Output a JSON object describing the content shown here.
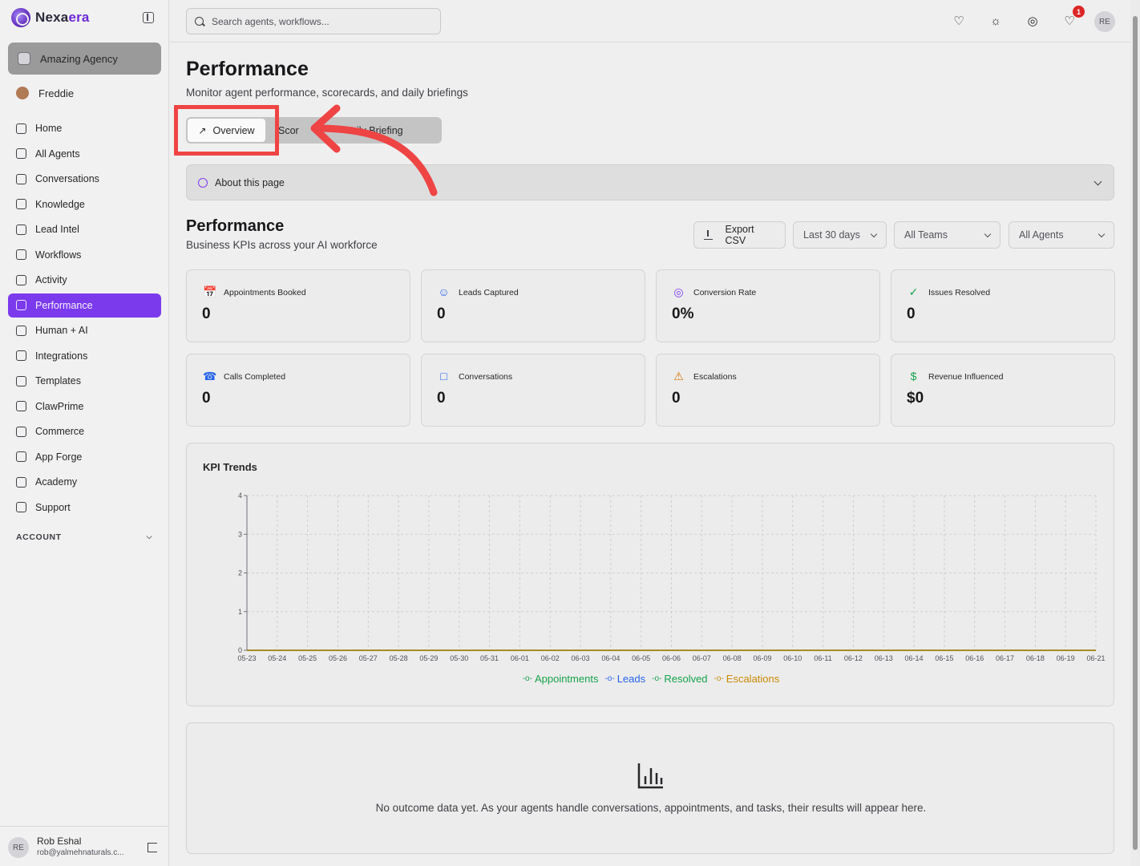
{
  "brand": {
    "name_part1": "Nexa",
    "name_part2": "era"
  },
  "workspace": {
    "name": "Amazing Agency"
  },
  "current_user": {
    "name": "Freddie"
  },
  "sidebar": {
    "items": [
      {
        "label": "Home",
        "icon": "home-icon"
      },
      {
        "label": "All Agents",
        "icon": "bot-icon"
      },
      {
        "label": "Conversations",
        "icon": "message-icon"
      },
      {
        "label": "Knowledge",
        "icon": "brain-icon"
      },
      {
        "label": "Lead Intel",
        "icon": "contact-icon"
      },
      {
        "label": "Workflows",
        "icon": "workflow-icon"
      },
      {
        "label": "Activity",
        "icon": "activity-icon"
      },
      {
        "label": "Performance",
        "icon": "trending-up-icon",
        "active": true
      },
      {
        "label": "Human + AI",
        "icon": "people-icon"
      },
      {
        "label": "Integrations",
        "icon": "plug-icon"
      },
      {
        "label": "Templates",
        "icon": "share-icon"
      },
      {
        "label": "ClawPrime",
        "icon": "claw-icon"
      },
      {
        "label": "Commerce",
        "icon": "cart-icon"
      },
      {
        "label": "App Forge",
        "icon": "sparkles-icon"
      },
      {
        "label": "Academy",
        "icon": "graduation-icon"
      },
      {
        "label": "Support",
        "icon": "lifebuoy-icon"
      }
    ],
    "account_label": "ACCOUNT"
  },
  "footer_user": {
    "initials": "RE",
    "name": "Rob Eshal",
    "email": "rob@yalmehnaturals.c..."
  },
  "topbar": {
    "search_placeholder": "Search agents, workflows...",
    "notification_count": "1",
    "avatar_initials": "RE"
  },
  "page": {
    "title": "Performance",
    "subtitle": "Monitor agent performance, scorecards, and daily briefings",
    "tabs": {
      "overview": "Overview",
      "scorecards_visible": "Scor",
      "briefing_visible": "aily Briefing"
    },
    "about": "About this page"
  },
  "section": {
    "title": "Performance",
    "subtitle": "Business KPIs across your AI workforce",
    "export_label": "Export CSV",
    "range": "Last 30 days",
    "teams": "All Teams",
    "agents": "All Agents"
  },
  "kpis": [
    {
      "label": "Appointments Booked",
      "value": "0",
      "icon": "calendar-check-icon",
      "color": "#16a34a"
    },
    {
      "label": "Leads Captured",
      "value": "0",
      "icon": "user-plus-icon",
      "color": "#2563eb"
    },
    {
      "label": "Conversion Rate",
      "value": "0%",
      "icon": "target-icon",
      "color": "#7c3aed"
    },
    {
      "label": "Issues Resolved",
      "value": "0",
      "icon": "check-circle-icon",
      "color": "#16a34a"
    },
    {
      "label": "Calls Completed",
      "value": "0",
      "icon": "phone-icon",
      "color": "#2563eb"
    },
    {
      "label": "Conversations",
      "value": "0",
      "icon": "message-icon",
      "color": "#2563eb"
    },
    {
      "label": "Escalations",
      "value": "0",
      "icon": "warning-icon",
      "color": "#d97706"
    },
    {
      "label": "Revenue Influenced",
      "value": "$0",
      "icon": "dollar-icon",
      "color": "#16a34a"
    }
  ],
  "chart_data": {
    "type": "line",
    "title": "KPI Trends",
    "x": [
      "05-23",
      "05-24",
      "05-25",
      "05-26",
      "05-27",
      "05-28",
      "05-29",
      "05-30",
      "05-31",
      "06-01",
      "06-02",
      "06-03",
      "06-04",
      "06-05",
      "06-06",
      "06-07",
      "06-08",
      "06-09",
      "06-10",
      "06-11",
      "06-12",
      "06-13",
      "06-14",
      "06-15",
      "06-16",
      "06-17",
      "06-18",
      "06-19",
      "06-21"
    ],
    "ylim": [
      0,
      4
    ],
    "yticks": [
      "0",
      "1",
      "2",
      "3",
      "4"
    ],
    "grid": true,
    "legend_position": "bottom",
    "series": [
      {
        "name": "Appointments",
        "color": "#16a34a",
        "values": [
          0,
          0,
          0,
          0,
          0,
          0,
          0,
          0,
          0,
          0,
          0,
          0,
          0,
          0,
          0,
          0,
          0,
          0,
          0,
          0,
          0,
          0,
          0,
          0,
          0,
          0,
          0,
          0,
          0
        ]
      },
      {
        "name": "Leads",
        "color": "#2563eb",
        "values": [
          0,
          0,
          0,
          0,
          0,
          0,
          0,
          0,
          0,
          0,
          0,
          0,
          0,
          0,
          0,
          0,
          0,
          0,
          0,
          0,
          0,
          0,
          0,
          0,
          0,
          0,
          0,
          0,
          0
        ]
      },
      {
        "name": "Resolved",
        "color": "#16a34a",
        "values": [
          0,
          0,
          0,
          0,
          0,
          0,
          0,
          0,
          0,
          0,
          0,
          0,
          0,
          0,
          0,
          0,
          0,
          0,
          0,
          0,
          0,
          0,
          0,
          0,
          0,
          0,
          0,
          0,
          0
        ]
      },
      {
        "name": "Escalations",
        "color": "#ca8a04",
        "values": [
          0,
          0,
          0,
          0,
          0,
          0,
          0,
          0,
          0,
          0,
          0,
          0,
          0,
          0,
          0,
          0,
          0,
          0,
          0,
          0,
          0,
          0,
          0,
          0,
          0,
          0,
          0,
          0,
          0
        ]
      }
    ]
  },
  "empty_state": {
    "text": "No outcome data yet. As your agents handle conversations, appointments, and tasks, their results will appear here."
  },
  "colors": {
    "accent": "#7c3aed",
    "annotation": "#ef4444"
  }
}
